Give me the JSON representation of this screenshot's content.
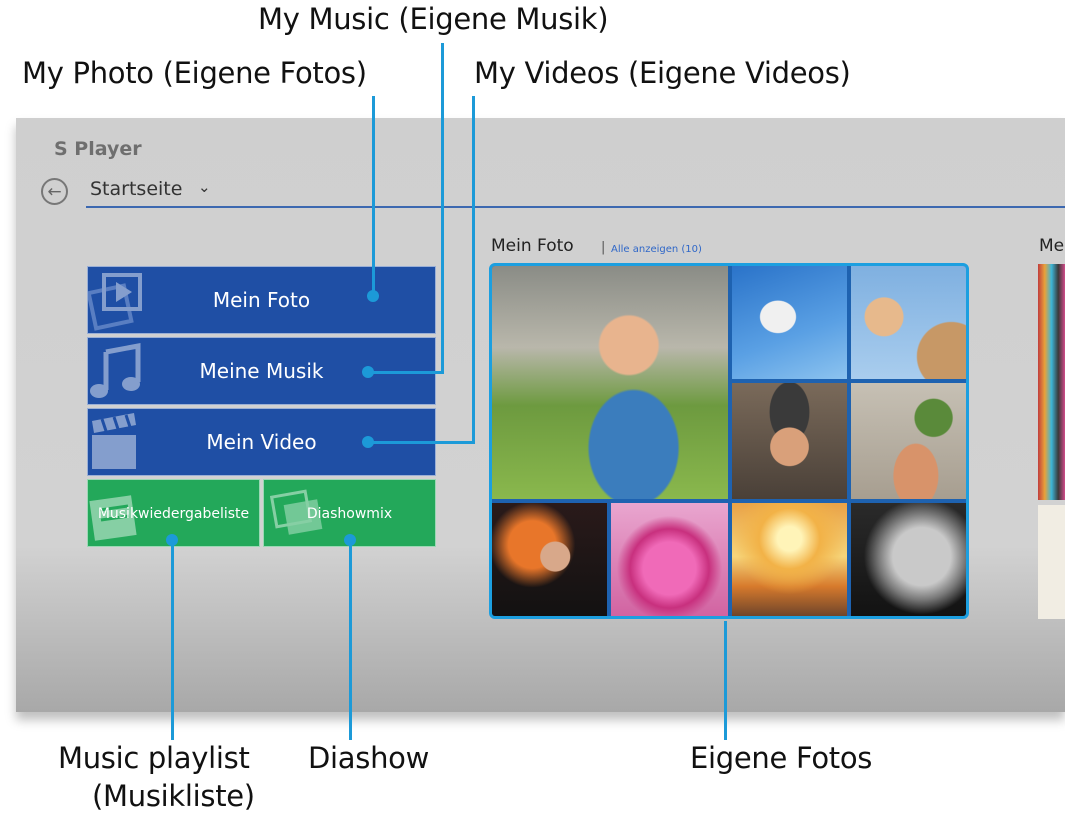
{
  "callouts": {
    "my_music": "My Music (Eigene Musik)",
    "my_photo": "My Photo (Eigene Fotos)",
    "my_videos": "My Videos (Eigene Videos)",
    "music_playlist_line1": "Music playlist",
    "music_playlist_line2": "(Musikliste)",
    "diashow": "Diashow",
    "eigene_fotos": "Eigene Fotos"
  },
  "app": {
    "title": "S Player",
    "back_icon": "back-arrow-icon",
    "nav_label": "Startseite",
    "nav_chevron": "⌄"
  },
  "tiles": {
    "mein_foto": "Mein Foto",
    "meine_musik": "Meine Musik",
    "mein_video": "Mein Video",
    "musikwiedergabeliste": "Musikwiedergabeliste",
    "diashowmix": "Diashowmix"
  },
  "section": {
    "title": "Mein Foto",
    "separator": "|",
    "show_all": "Alle anzeigen (10)",
    "next_title": "Me"
  },
  "colors": {
    "tile_blue": "#1f4fa5",
    "tile_green": "#23a85a",
    "callout_line": "#1c9ad8",
    "accent_rule": "#3c68b0"
  }
}
